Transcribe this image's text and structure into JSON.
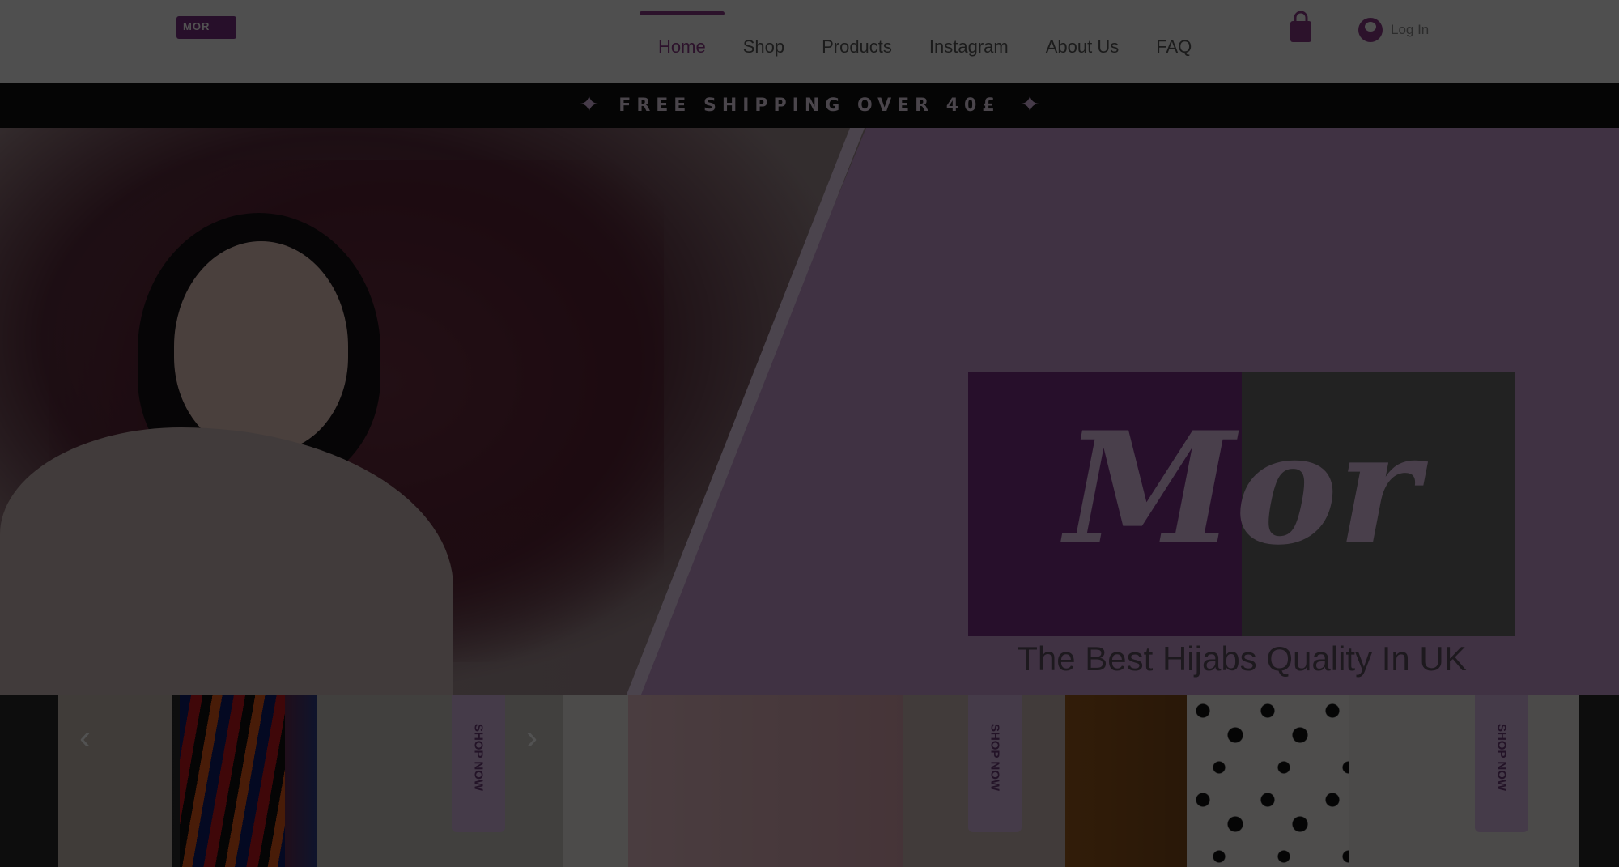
{
  "header": {
    "logo": "MOR",
    "nav": [
      "Home",
      "Shop",
      "Products",
      "Instagram",
      "About Us",
      "FAQ"
    ],
    "active_nav": "Home",
    "login_label": "Log In"
  },
  "promo": {
    "text": "FREE SHIPPING OVER 40£"
  },
  "hero": {
    "brand": "Mor",
    "tagline": "The Best Hijabs Quality In UK"
  },
  "products": {
    "cards": [
      {
        "tab_label": "SHOP NOW"
      },
      {
        "tab_label": "SHOP NOW"
      },
      {
        "tab_label": "SHOP NOW"
      }
    ],
    "prev_arrow": "‹",
    "next_arrow": "›"
  },
  "colors": {
    "accent": "#8a3a86",
    "hero_bg": "#c89bd0",
    "tab_bg": "#d5b7e3",
    "promo_bg": "#111111"
  },
  "icons": {
    "cart": "shopping-bag-icon",
    "avatar": "user-avatar-icon",
    "promo_sparkle": "sparkle-icon"
  }
}
